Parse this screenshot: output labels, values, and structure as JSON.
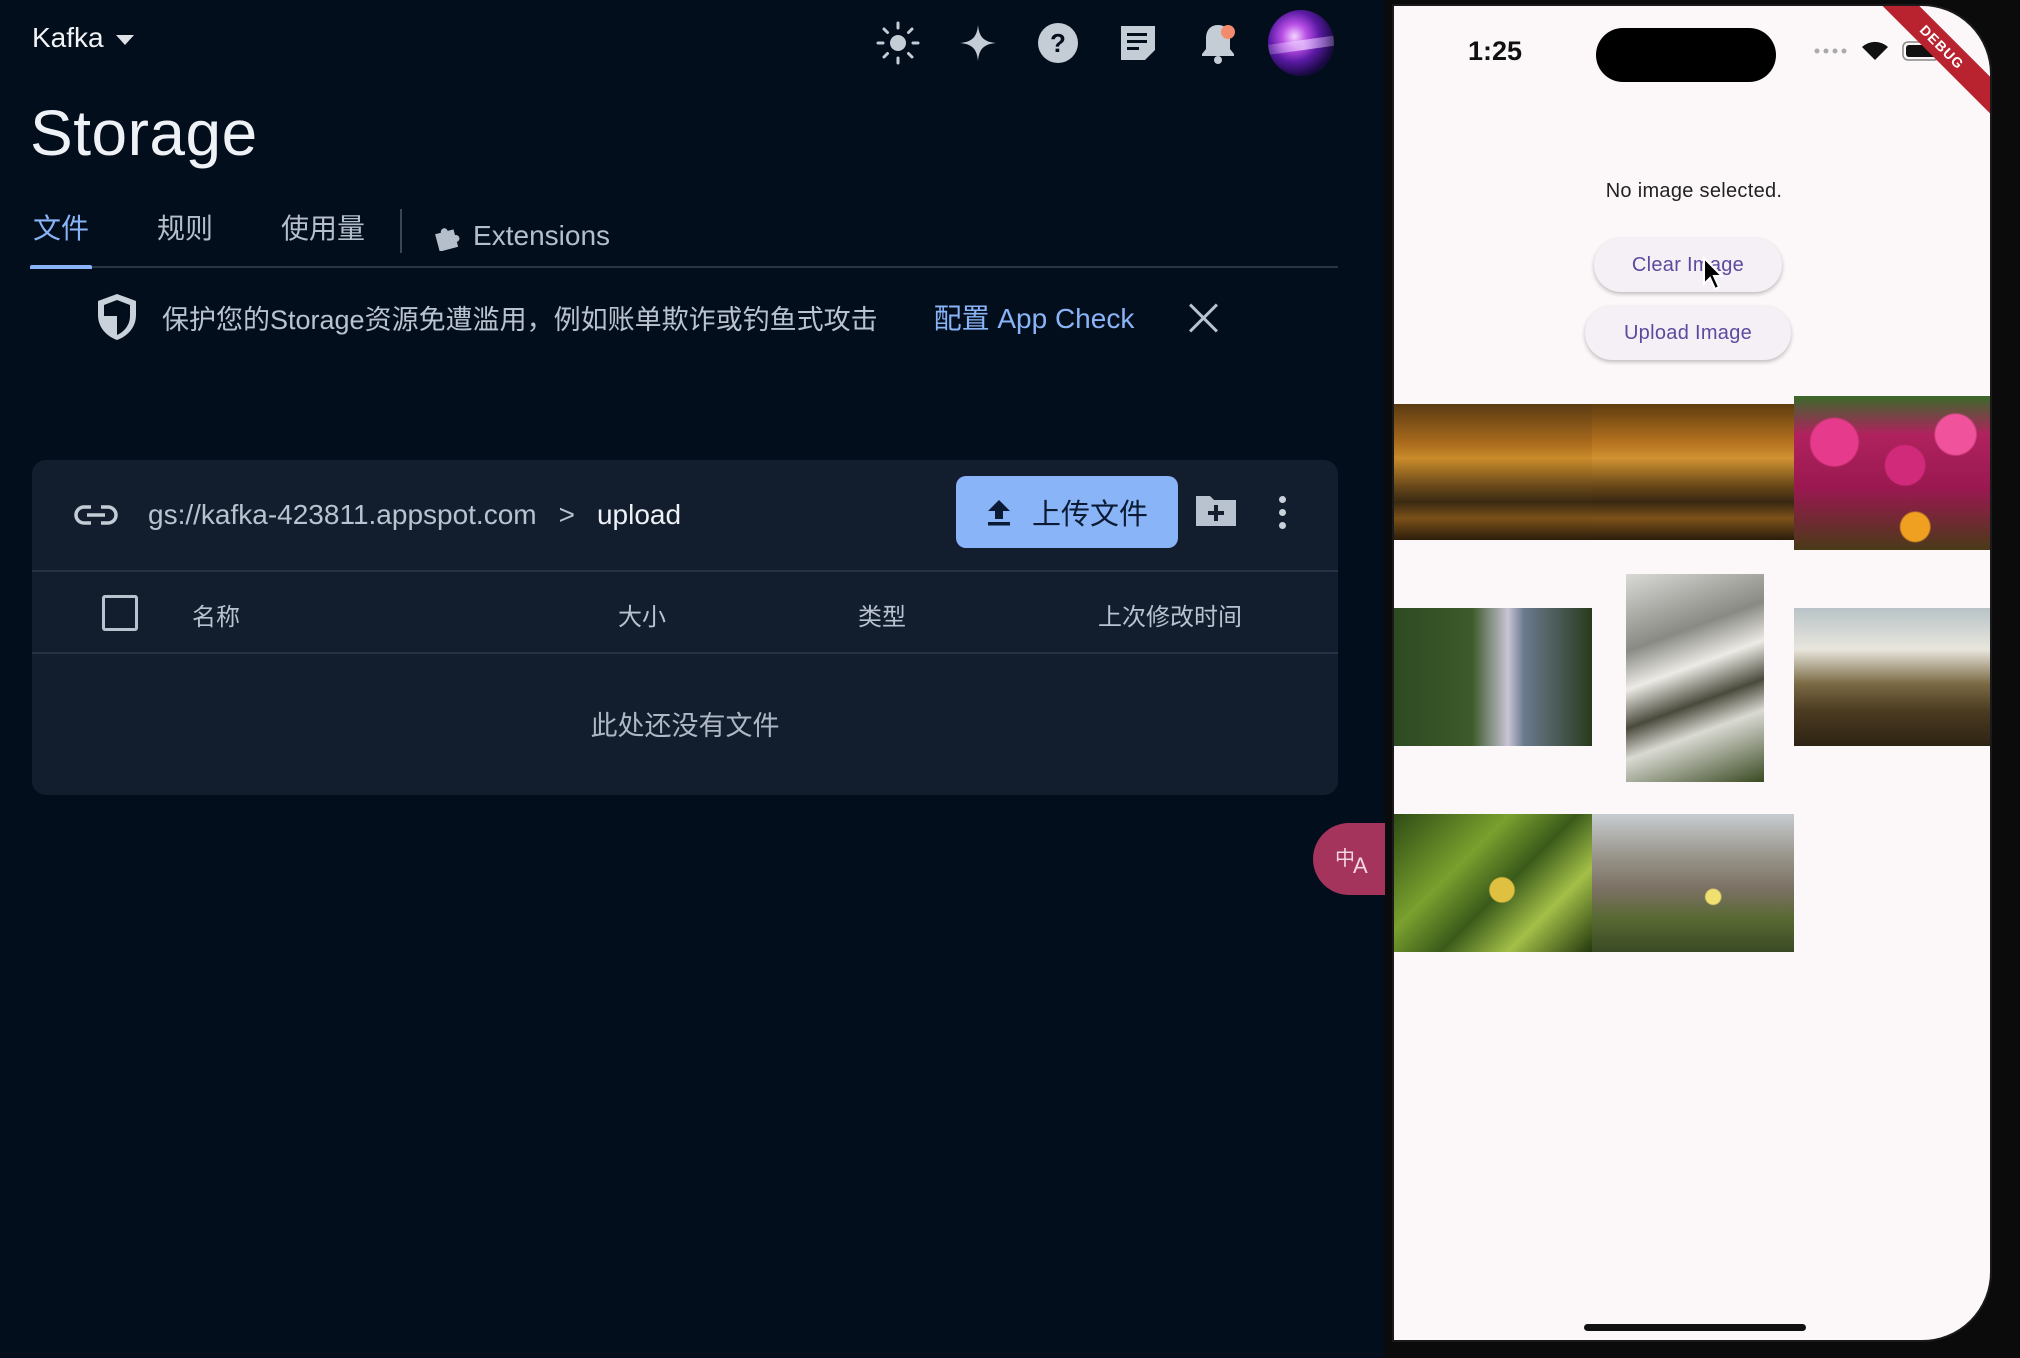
{
  "console": {
    "project_name": "Kafka",
    "page_title": "Storage",
    "tabs": [
      {
        "label": "文件",
        "active": true
      },
      {
        "label": "规则",
        "active": false
      },
      {
        "label": "使用量",
        "active": false
      },
      {
        "label": "Extensions",
        "active": false
      }
    ],
    "top_icons": [
      "theme-toggle-icon",
      "gemini-sparkle-icon",
      "help-icon",
      "feedback-icon",
      "notifications-icon",
      "user-avatar"
    ],
    "banner": {
      "text": "保护您的Storage资源免遭滥用，例如账单欺诈或钓鱼式攻击",
      "link": "配置 App Check"
    },
    "bucket": {
      "root": "gs://kafka-423811.appspot.com",
      "separator": ">",
      "current": "upload",
      "upload_label": "上传文件"
    },
    "table": {
      "columns": [
        "名称",
        "大小",
        "类型",
        "上次修改时间"
      ],
      "empty_text": "此处还没有文件"
    },
    "colors": {
      "accent": "#8ab4f8",
      "background": "#030e1c",
      "card": "#121d2e"
    }
  },
  "phone": {
    "time": "1:25",
    "debug_badge": "DEBUG",
    "status_text": "No image selected.",
    "clear_button": "Clear Image",
    "upload_button": "Upload Image",
    "photos": [
      "autumn-lake-photo",
      "autumn-lake-photo-2",
      "pink-flowers-photo",
      "waterfall-cliff-photo",
      "waterfall-rocks-photo",
      "coastal-waterfall-photo",
      "green-leaves-photo",
      "dune-grass-photo"
    ]
  }
}
